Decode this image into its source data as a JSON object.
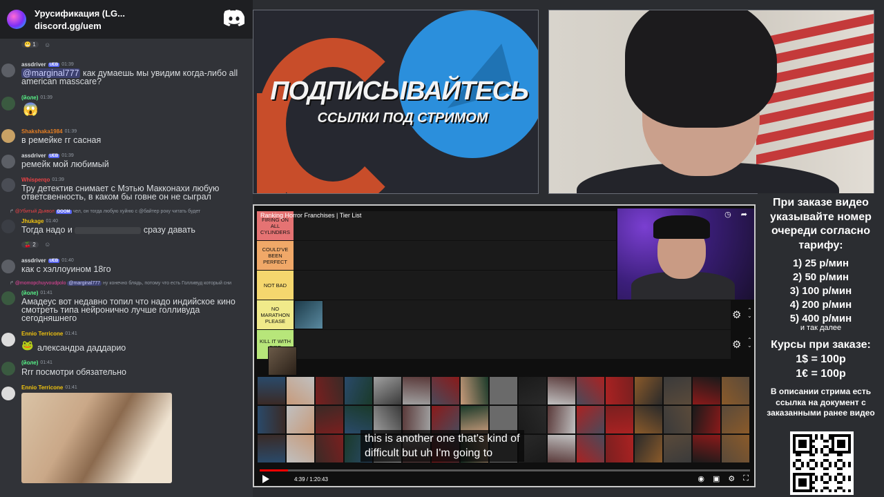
{
  "server": {
    "name": "Урусификация (LG...",
    "invite": "discord.gg/uem"
  },
  "messages": [
    {
      "user": "assdriver",
      "role": "UEB",
      "time": "01:39",
      "mention": "@marginal777",
      "text": "как думаешь мы увидим когда-либо all american masscare?",
      "name_color": "#dbdee1"
    },
    {
      "user": "(йоле)",
      "role": "",
      "time": "01:39",
      "text": "",
      "name_color": "#57f287"
    },
    {
      "user": "Shakshaka1984",
      "role": "",
      "time": "01:39",
      "text": "в ремейке гг сасная",
      "name_color": "#e67e22"
    },
    {
      "user": "assdriver",
      "role": "UEB",
      "time": "01:39",
      "text": "ремейк мой любимый",
      "name_color": "#dbdee1"
    },
    {
      "user": "Whisperqo",
      "role": "",
      "time": "01:39",
      "text": "Тру детектив снимает с Мэтью Макконахи любую ответсвенность, в каком бы говне он не сыграл",
      "name_color": "#ed4245"
    },
    {
      "user": "Jhukage",
      "role": "",
      "time": "01:40",
      "reply_user": "@Убитый Дьявол",
      "reply_role": "DOOM",
      "reply_text": "чел, он тогда любую хуйню с @байтер року читать будет",
      "text_a": "Тогда надо и",
      "text_b": "сразу давать",
      "name_color": "#f1c40f",
      "reaction": "2"
    },
    {
      "user": "assdriver",
      "role": "UEB",
      "time": "01:40",
      "text": "как с хэллоуином 18го",
      "name_color": "#dbdee1"
    },
    {
      "user": "(йоле)",
      "role": "",
      "time": "01:41",
      "reply_user": "@momopchuyvoudpolo",
      "reply_mention": "@marginal777",
      "reply_text": "ну конечно блядь, потому что есть Голливуд который сни",
      "text": "Амадеус вот недавно топил что надо индийское кино смотреть типа нейронично лучше голливуда сегодняшнего",
      "name_color": "#57f287"
    },
    {
      "user": "Ennio Terricone",
      "role": "",
      "time": "01:41",
      "text": "александра даддарио",
      "name_color": "#f1c40f"
    },
    {
      "user": "(йоле)",
      "role": "",
      "time": "01:41",
      "text": "Rrr посмотри обязательно",
      "name_color": "#57f287"
    },
    {
      "user": "Ennio Terricone",
      "role": "",
      "time": "01:41",
      "text": "",
      "name_color": "#f1c40f"
    }
  ],
  "first_reaction": "1",
  "promo": {
    "title": "ПОДПИСЫВАЙТЕСЬ",
    "subtitle": "ССЫЛКИ ПОД СТРИМОМ"
  },
  "video": {
    "title": "Ranking Horror Franchises | Tier List",
    "caption_line1": "this is another one that's kind of",
    "caption_line2": "difficult but uh I'm going to",
    "time": "4:39 / 1:20:43",
    "progress": 0.058,
    "tiers": [
      {
        "label": "FIRING ON ALL CYLINDERS",
        "color": "#e57373"
      },
      {
        "label": "COULD'VE BEEN PERFECT",
        "color": "#f0a868"
      },
      {
        "label": "NOT BAD",
        "color": "#f5d76e"
      },
      {
        "label": "NO MARATHON PLEASE",
        "color": "#f0ea8a"
      },
      {
        "label": "KILL IT WITH FIRE",
        "color": "#b7e67a"
      }
    ]
  },
  "info": {
    "order_text": "При заказе видео указывайте номер очереди согласно тарифу:",
    "tariffs": [
      "1) 25 р/мин",
      "2) 50 р/мин",
      "3) 100 р/мин",
      "4) 200 р/мин",
      "5) 400 р/мин"
    ],
    "etc": "и так далее",
    "courses_title": "Курсы при заказе:",
    "courses": [
      "1$ = 100р",
      "1€ = 100р"
    ],
    "description": "В описании стрима есть ссылка на документ с заказанными ранее видео"
  }
}
